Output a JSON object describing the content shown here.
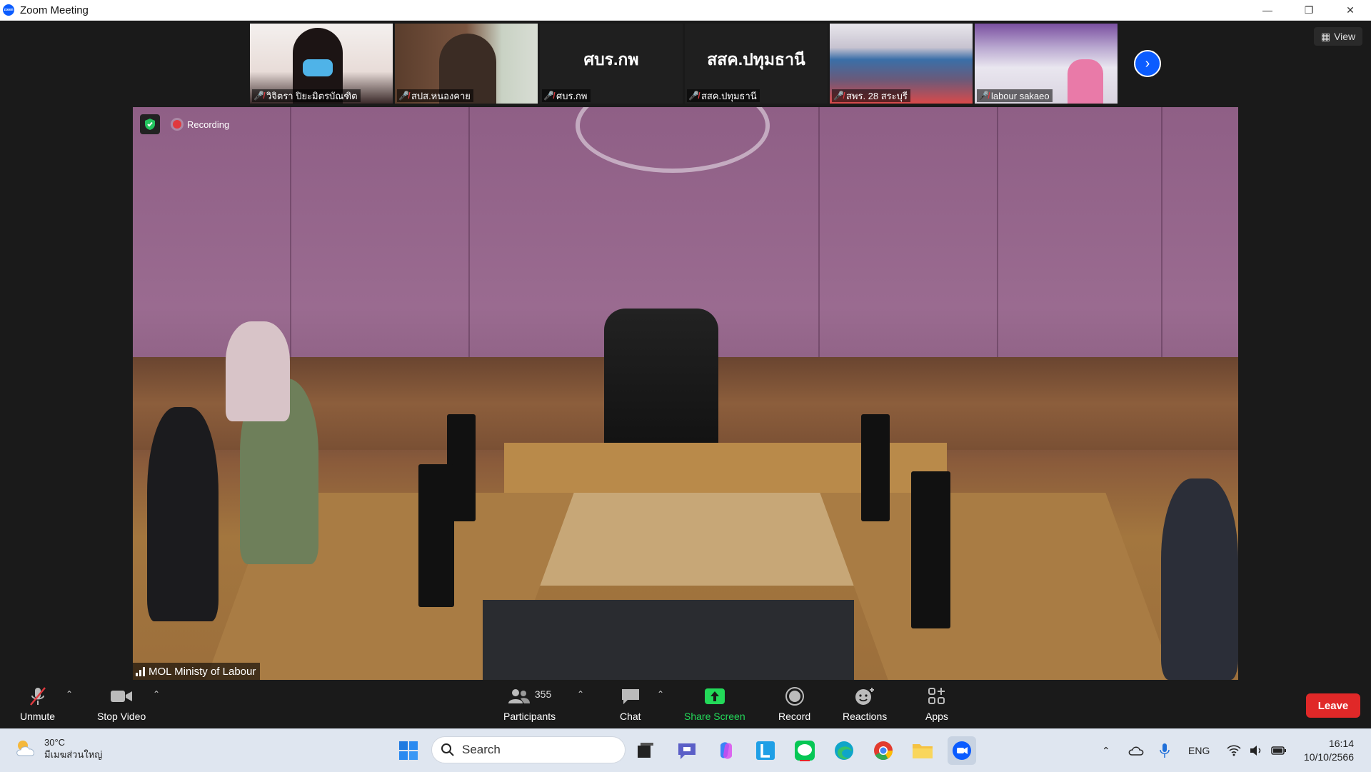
{
  "window": {
    "title": "Zoom Meeting",
    "controls": [
      "minimize",
      "restore",
      "close"
    ]
  },
  "thumbnails": [
    {
      "name": "วิจิตรา ปิยะมิตรบัณฑิต",
      "muted": true,
      "type": "video"
    },
    {
      "name": "สปส.หนองคาย",
      "muted": true,
      "type": "video"
    },
    {
      "name": "ศบร.กพ",
      "display_name": "ศบร.กพ",
      "muted": true,
      "type": "namecard"
    },
    {
      "name": "สสค.ปทุมธานี",
      "display_name": "สสค.ปทุมธานี",
      "muted": true,
      "type": "namecard"
    },
    {
      "name": "สพร. 28 สระบุรี",
      "muted": true,
      "type": "video"
    },
    {
      "name": "labour sakaeo",
      "muted": true,
      "type": "video"
    }
  ],
  "view_button": {
    "label": "View"
  },
  "main_video": {
    "recording_label": "Recording",
    "speaker_name": "MOL Ministy of Labour"
  },
  "toolbar": {
    "unmute": "Unmute",
    "stop_video": "Stop Video",
    "participants_count": "355",
    "participants": "Participants",
    "chat": "Chat",
    "share_screen": "Share Screen",
    "record": "Record",
    "reactions": "Reactions",
    "apps": "Apps",
    "leave": "Leave"
  },
  "taskbar": {
    "weather_temp": "30°C",
    "weather_place": "มีเมฆส่วนใหญ่",
    "search_placeholder": "Search",
    "language": "ENG",
    "time": "16:14",
    "date": "10/10/2566"
  },
  "colors": {
    "zoom_blue": "#0b5cff",
    "leave_red": "#e02828",
    "share_green": "#23d959",
    "muted_red": "#e0393e"
  }
}
